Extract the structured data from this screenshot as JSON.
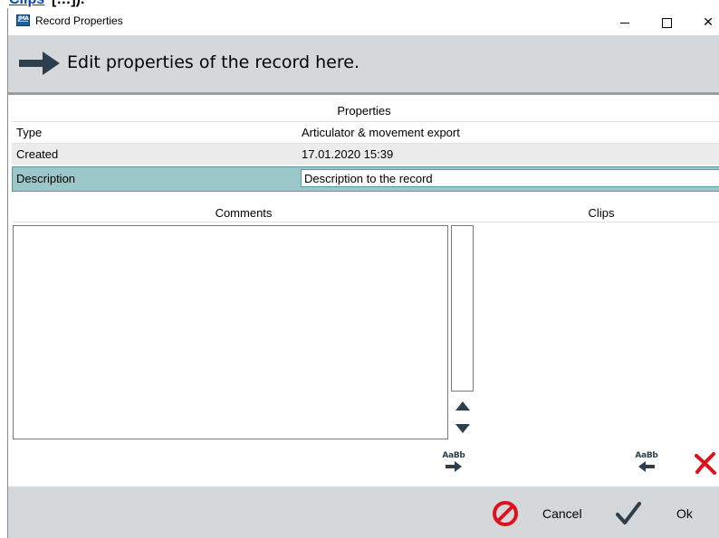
{
  "background_fragment": {
    "link_text": "Clips",
    "rest_text": "[…])."
  },
  "window": {
    "title": "Record Properties",
    "app_icon_text": "JMA",
    "controls": {
      "minimize": "minimize",
      "maximize": "maximize",
      "close": "✕"
    }
  },
  "header": {
    "text": "Edit properties of the record here.",
    "icon": "right-arrow-icon"
  },
  "properties": {
    "title": "Properties",
    "rows": [
      {
        "label": "Type",
        "value": "Articulator & movement export"
      },
      {
        "label": "Created",
        "value": "17.01.2020 15:39"
      },
      {
        "label": "Description",
        "value": "Description to the record"
      }
    ]
  },
  "comments": {
    "title": "Comments",
    "value": ""
  },
  "clips": {
    "title": "Clips"
  },
  "transfer": {
    "to_clips_label": "AaBb",
    "from_clips_label": "AaBb"
  },
  "footer": {
    "cancel_label": "Cancel",
    "ok_label": "Ok"
  },
  "colors": {
    "band": "#d5d8da",
    "selected_row": "#9cc7c9",
    "accent_dark": "#2d3e4d",
    "cancel_red": "#e0101a",
    "delete_red": "#e0101a"
  }
}
